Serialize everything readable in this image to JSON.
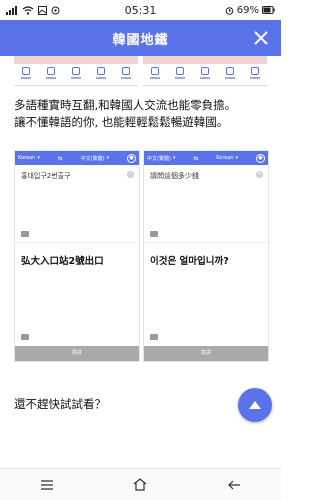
{
  "status_bar": {
    "time": "05:31",
    "battery": "69%"
  },
  "header": {
    "title": "韓國地鐵"
  },
  "intro": {
    "line1": "多語種實時互翻,和韓國人交流也能零負擔。",
    "line2": "讓不懂韓語的你, 也能輕輕鬆鬆暢遊韓國。"
  },
  "cards": [
    {
      "src_lang": "Korean",
      "dst_lang": "中文(繁體)",
      "input_text": "홍대입구2번출구",
      "output_text": "弘大入口站2號出口",
      "button": "翻譯"
    },
    {
      "src_lang": "中文(繁體)",
      "dst_lang": "Korean",
      "input_text": "請問這個多少錢",
      "output_text": "이것은 얼마입니까?",
      "button": "翻譯"
    }
  ],
  "cta": {
    "text": "還不趕快試試看？"
  },
  "colors": {
    "primary": "#5a73ea"
  },
  "icons": {
    "close": "close-icon",
    "fab": "scroll-top-icon",
    "nav": [
      "menu-icon",
      "home-icon",
      "back-icon"
    ]
  }
}
